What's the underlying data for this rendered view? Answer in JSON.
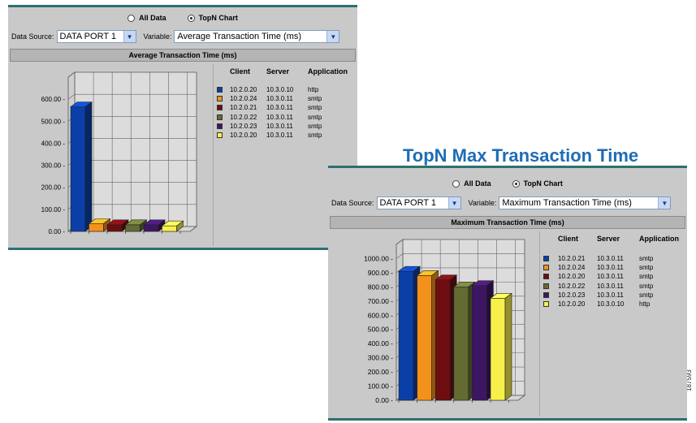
{
  "heading": "TopN Max Transaction Time",
  "side_code": "187593",
  "panels": [
    {
      "radio_all": "All Data",
      "radio_topn": "TopN Chart",
      "selected_radio": "topn",
      "data_source_label": "Data Source:",
      "data_source_value": "DATA PORT 1",
      "variable_label": "Variable:",
      "variable_value": "Average Transaction Time (ms)",
      "chart_title": "Average Transaction Time (ms)",
      "legend_headers": {
        "client": "Client",
        "server": "Server",
        "application": "Application"
      },
      "legend": [
        {
          "client": "10.2.0.20",
          "server": "10.3.0.10",
          "application": "http",
          "color": "#0b3fa8"
        },
        {
          "client": "10.2.0.24",
          "server": "10.3.0.11",
          "application": "smtp",
          "color": "#f3921a"
        },
        {
          "client": "10.2.0.21",
          "server": "10.3.0.11",
          "application": "smtp",
          "color": "#6e0d10"
        },
        {
          "client": "10.2.0.22",
          "server": "10.3.0.11",
          "application": "smtp",
          "color": "#636b33"
        },
        {
          "client": "10.2.0.23",
          "server": "10.3.0.11",
          "application": "smtp",
          "color": "#3d1663"
        },
        {
          "client": "10.2.0.20",
          "server": "10.3.0.11",
          "application": "smtp",
          "color": "#f7f04a"
        }
      ]
    },
    {
      "radio_all": "All Data",
      "radio_topn": "TopN Chart",
      "selected_radio": "topn",
      "data_source_label": "Data Source:",
      "data_source_value": "DATA PORT 1",
      "variable_label": "Variable:",
      "variable_value": "Maximum Transaction Time (ms)",
      "chart_title": "Maximum Transaction Time (ms)",
      "legend_headers": {
        "client": "Client",
        "server": "Server",
        "application": "Application"
      },
      "legend": [
        {
          "client": "10.2.0.21",
          "server": "10.3.0.11",
          "application": "smtp",
          "color": "#0b3fa8"
        },
        {
          "client": "10.2.0.24",
          "server": "10.3.0.11",
          "application": "smtp",
          "color": "#f3921a"
        },
        {
          "client": "10.2.0.20",
          "server": "10.3.0.11",
          "application": "smtp",
          "color": "#6e0d10"
        },
        {
          "client": "10.2.0.22",
          "server": "10.3.0.11",
          "application": "smtp",
          "color": "#636b33"
        },
        {
          "client": "10.2.0.23",
          "server": "10.3.0.11",
          "application": "smtp",
          "color": "#3d1663"
        },
        {
          "client": "10.2.0.20",
          "server": "10.3.0.10",
          "application": "http",
          "color": "#f7f04a"
        }
      ]
    }
  ],
  "chart_data": [
    {
      "type": "bar",
      "title": "Average Transaction Time (ms)",
      "categories": [
        "10.2.0.20 / 10.3.0.10 http",
        "10.2.0.24 / 10.3.0.11 smtp",
        "10.2.0.21 / 10.3.0.11 smtp",
        "10.2.0.22 / 10.3.0.11 smtp",
        "10.2.0.23 / 10.3.0.11 smtp",
        "10.2.0.20 / 10.3.0.11 smtp"
      ],
      "values": [
        565,
        35,
        30,
        30,
        30,
        25
      ],
      "yticks": [
        "0.00",
        "100.00",
        "200.00",
        "300.00",
        "400.00",
        "500.00",
        "600.00"
      ],
      "ylim": [
        0,
        700
      ],
      "grid": true
    },
    {
      "type": "bar",
      "title": "Maximum Transaction Time (ms)",
      "categories": [
        "10.2.0.21 / 10.3.0.11 smtp",
        "10.2.0.24 / 10.3.0.11 smtp",
        "10.2.0.20 / 10.3.0.11 smtp",
        "10.2.0.22 / 10.3.0.11 smtp",
        "10.2.0.23 / 10.3.0.11 smtp",
        "10.2.0.20 / 10.3.0.10 http"
      ],
      "values": [
        910,
        880,
        850,
        800,
        810,
        720
      ],
      "yticks": [
        "0.00",
        "100.00",
        "200.00",
        "300.00",
        "400.00",
        "500.00",
        "600.00",
        "700.00",
        "800.00",
        "900.00",
        "1000.00"
      ],
      "ylim": [
        0,
        1100
      ],
      "grid": true
    }
  ]
}
